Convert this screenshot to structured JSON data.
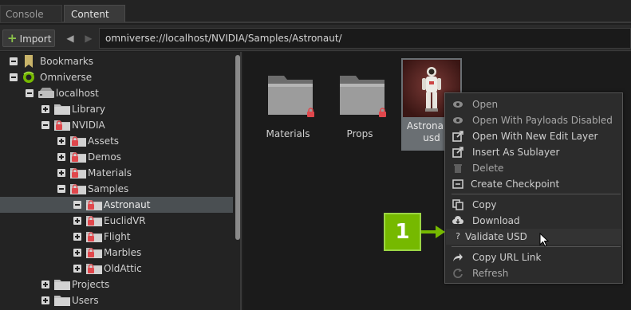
{
  "tabs": [
    {
      "label": "Console",
      "active": false
    },
    {
      "label": "Content",
      "active": true
    }
  ],
  "toolbar": {
    "import_label": "Import",
    "back_icon": "chevron-left-icon",
    "forward_icon": "chevron-right-icon",
    "path": "omniverse://localhost/NVIDIA/Samples/Astronaut/"
  },
  "tree": {
    "items": [
      {
        "label": "Bookmarks",
        "icon": "bookmark-icon",
        "expanded": true
      },
      {
        "label": "Omniverse",
        "icon": "omniverse-icon",
        "expanded": true
      },
      {
        "label": "localhost",
        "icon": "server-icon",
        "expanded": true
      },
      {
        "label": "Library",
        "icon": "folder-icon",
        "expanded": false
      },
      {
        "label": "NVIDIA",
        "icon": "locked-folder-icon",
        "expanded": true
      },
      {
        "label": "Assets",
        "icon": "locked-folder-icon",
        "expanded": false
      },
      {
        "label": "Demos",
        "icon": "locked-folder-icon",
        "expanded": false
      },
      {
        "label": "Materials",
        "icon": "locked-folder-icon",
        "expanded": false
      },
      {
        "label": "Samples",
        "icon": "locked-folder-icon",
        "expanded": true
      },
      {
        "label": "Astronaut",
        "icon": "locked-folder-icon",
        "expanded": true,
        "selected": true
      },
      {
        "label": "EuclidVR",
        "icon": "locked-folder-icon",
        "expanded": false
      },
      {
        "label": "Flight",
        "icon": "locked-folder-icon",
        "expanded": false
      },
      {
        "label": "Marbles",
        "icon": "locked-folder-icon",
        "expanded": false
      },
      {
        "label": "OldAttic",
        "icon": "locked-folder-icon",
        "expanded": false
      },
      {
        "label": "Projects",
        "icon": "folder-icon",
        "expanded": false
      },
      {
        "label": "Users",
        "icon": "folder-icon",
        "expanded": false
      }
    ]
  },
  "content": {
    "items": [
      {
        "label": "Materials",
        "icon": "folder-icon",
        "locked": true
      },
      {
        "label": "Props",
        "icon": "folder-icon",
        "locked": true
      },
      {
        "label": "Astronaut.usd",
        "label_line1": "Astronaut.",
        "label_line2": "usd",
        "icon": "astronaut-thumbnail",
        "selected": true
      }
    ]
  },
  "context_menu": {
    "items": [
      {
        "label": "Open",
        "icon": "eye-icon",
        "disabled": true
      },
      {
        "label": "Open With Payloads Disabled",
        "icon": "eye-icon",
        "disabled": true
      },
      {
        "label": "Open With New Edit Layer",
        "icon": "external-link-icon"
      },
      {
        "label": "Insert As Sublayer",
        "icon": "external-link-icon"
      },
      {
        "label": "Delete",
        "icon": "trash-icon",
        "disabled": true
      },
      {
        "label": "Create Checkpoint",
        "icon": "checkpoint-icon"
      },
      {
        "label": "Copy",
        "icon": "copy-icon"
      },
      {
        "label": "Download",
        "icon": "cloud-download-icon"
      },
      {
        "label": "Validate USD",
        "icon": "question-icon",
        "highlighted": true
      },
      {
        "label": "Copy URL Link",
        "icon": "share-icon"
      },
      {
        "label": "Refresh",
        "icon": "refresh-icon",
        "disabled": true
      }
    ]
  },
  "callout": {
    "number": "1",
    "color": "#76b900"
  },
  "colors": {
    "accent": "#76b900",
    "lock": "#e0474c",
    "background": "#1b1b1b"
  }
}
